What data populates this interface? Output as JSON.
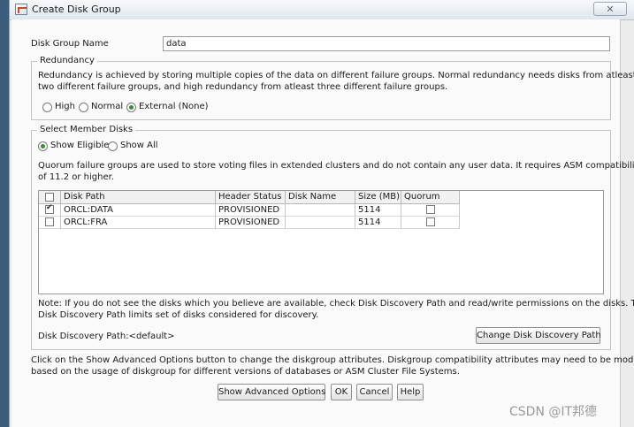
{
  "window": {
    "title": "Create Disk Group",
    "close_glyph": "✕"
  },
  "disk_group_name": {
    "label": "Disk Group Name",
    "value": "data"
  },
  "redundancy": {
    "legend": "Redundancy",
    "description_line1": "Redundancy is achieved by storing multiple copies of the data on different failure groups. Normal redundancy needs disks from atleast",
    "description_line2": "two different failure groups, and high redundancy from atleast three different failure groups.",
    "options": [
      {
        "label": "High",
        "selected": false
      },
      {
        "label": "Normal",
        "selected": false
      },
      {
        "label": "External (None)",
        "selected": true
      }
    ]
  },
  "member_disks": {
    "legend": "Select Member Disks",
    "filters": [
      {
        "label": "Show Eligible",
        "selected": true
      },
      {
        "label": "Show All",
        "selected": false
      }
    ],
    "quorum_note_line1": "Quorum failure groups are used to store voting files in extended clusters and do not contain any user data. It requires ASM compatibility",
    "quorum_note_line2": "of 11.2 or higher.",
    "table": {
      "columns": [
        "Disk Path",
        "Header Status",
        "Disk Name",
        "Size (MB)",
        "Quorum"
      ],
      "rows": [
        {
          "selected": true,
          "disk_path": "ORCL:DATA",
          "header_status": "PROVISIONED",
          "disk_name": "",
          "size_mb": "5114",
          "quorum": false
        },
        {
          "selected": false,
          "disk_path": "ORCL:FRA",
          "header_status": "PROVISIONED",
          "disk_name": "",
          "size_mb": "5114",
          "quorum": false
        }
      ]
    },
    "discovery_note_line1": "Note: If you do not see the disks which you believe are available, check Disk Discovery Path and read/write permissions on the disks. The",
    "discovery_note_line2": "Disk Discovery Path limits set of disks considered for discovery.",
    "discovery_path_label": "Disk Discovery Path:<default>",
    "change_discovery_button": "Change Disk Discovery Path"
  },
  "advanced_note_line1": "Click on the Show Advanced Options button to change the diskgroup attributes. Diskgroup compatibility attributes may need to be modified",
  "advanced_note_line2": "based on the usage of diskgroup for different versions of databases or ASM Cluster File Systems.",
  "buttons": {
    "show_advanced": "Show Advanced Options",
    "ok": "OK",
    "cancel": "Cancel",
    "help": "Help"
  },
  "watermark": "CSDN @IT邦德"
}
